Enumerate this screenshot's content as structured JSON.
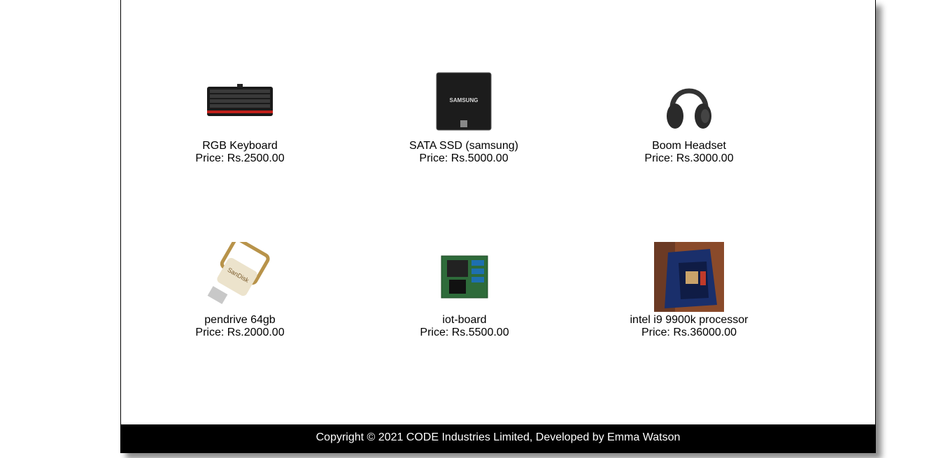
{
  "products": [
    {
      "name": "RGB Keyboard",
      "price_label": "Price:",
      "price": "Rs.2500.00",
      "icon": "keyboard-icon"
    },
    {
      "name": "SATA SSD (samsung)",
      "price_label": "Price:",
      "price": "Rs.5000.00",
      "icon": "ssd-icon",
      "brand": "SAMSUNG"
    },
    {
      "name": "Boom Headset",
      "price_label": "Price:",
      "price": "Rs.3000.00",
      "icon": "headset-icon"
    },
    {
      "name": "pendrive 64gb",
      "price_label": "Price:",
      "price": "Rs.2000.00",
      "icon": "pendrive-icon",
      "brand": "SanDisk"
    },
    {
      "name": "iot-board",
      "price_label": "Price:",
      "price": "Rs.5500.00",
      "icon": "circuit-board-icon"
    },
    {
      "name": "intel i9 9900k processor",
      "price_label": "Price:",
      "price": "Rs.36000.00",
      "icon": "processor-box-icon"
    }
  ],
  "footer": {
    "text": "Copyright © 2021 CODE Industries Limited, Developed by Emma Watson"
  }
}
